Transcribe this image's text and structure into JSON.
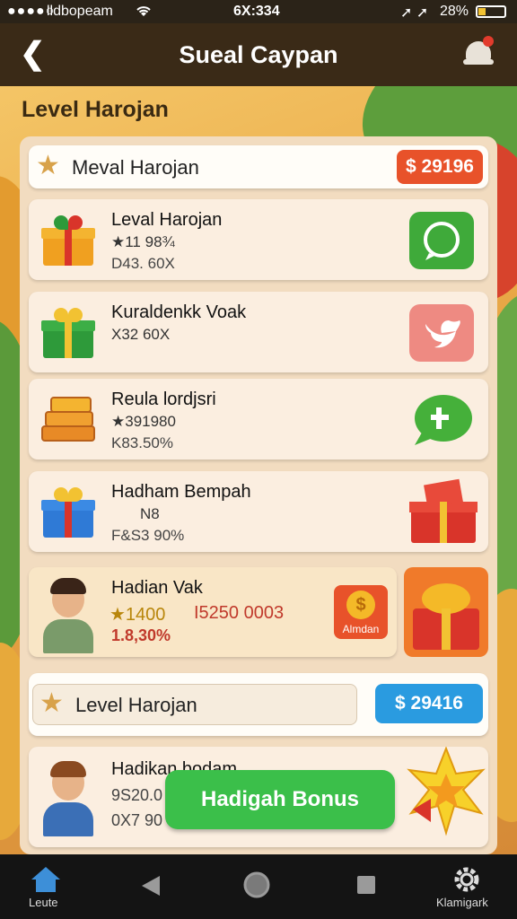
{
  "status_bar": {
    "signal": "●●●●○",
    "carrier": "lldbopeam",
    "time": "6X:334",
    "arrows": "➚ ➚",
    "battery_text": "28%",
    "battery_level": 0.28
  },
  "header": {
    "back_glyph": "❮",
    "title": "Sueal Caypan"
  },
  "page": {
    "heading": "Level Harojan"
  },
  "section1": {
    "label": "Meval Harojan",
    "badge": "$ 29196"
  },
  "cards": [
    {
      "name": "Leval Harojan",
      "line2": "★11 98¾",
      "line3": "D43. 60X",
      "icon": "whatsapp-icon",
      "icon_glyph": "✆"
    },
    {
      "name": "Kuraldenkk Voak",
      "line2": "X32 60X",
      "line3": "",
      "icon": "twitter-icon",
      "icon_glyph": "🐦"
    },
    {
      "name": "Reula lordjsri",
      "line2": "★391980",
      "line3": "K83.50%",
      "icon": "chat-icon",
      "icon_glyph": "✚"
    },
    {
      "name": "Hadham Bempah",
      "line2": "N8",
      "line3": "F&S3 90%",
      "icon": "gift-box-icon",
      "icon_glyph": ""
    }
  ],
  "highlight": {
    "name": "Hadian Vak",
    "points": "★1400",
    "value": "I5250 0003",
    "percent": "1.8,30%",
    "badge": "Almdan",
    "coin_symbol": "$"
  },
  "section2": {
    "label": "Level Harojan",
    "badge": "$ 29416"
  },
  "last_card": {
    "name": "Hadikan bodam",
    "line2": "9S20.0",
    "line3": "0X7 90"
  },
  "bonus_button": "Hadigah Bonus",
  "nav": {
    "home": "Leute",
    "settings": "Klamigark"
  },
  "colors": {
    "orange_badge": "#e8522a",
    "blue_badge": "#2a9be0",
    "green_button": "#3bbf4a",
    "header_bg": "#3a2a17"
  }
}
